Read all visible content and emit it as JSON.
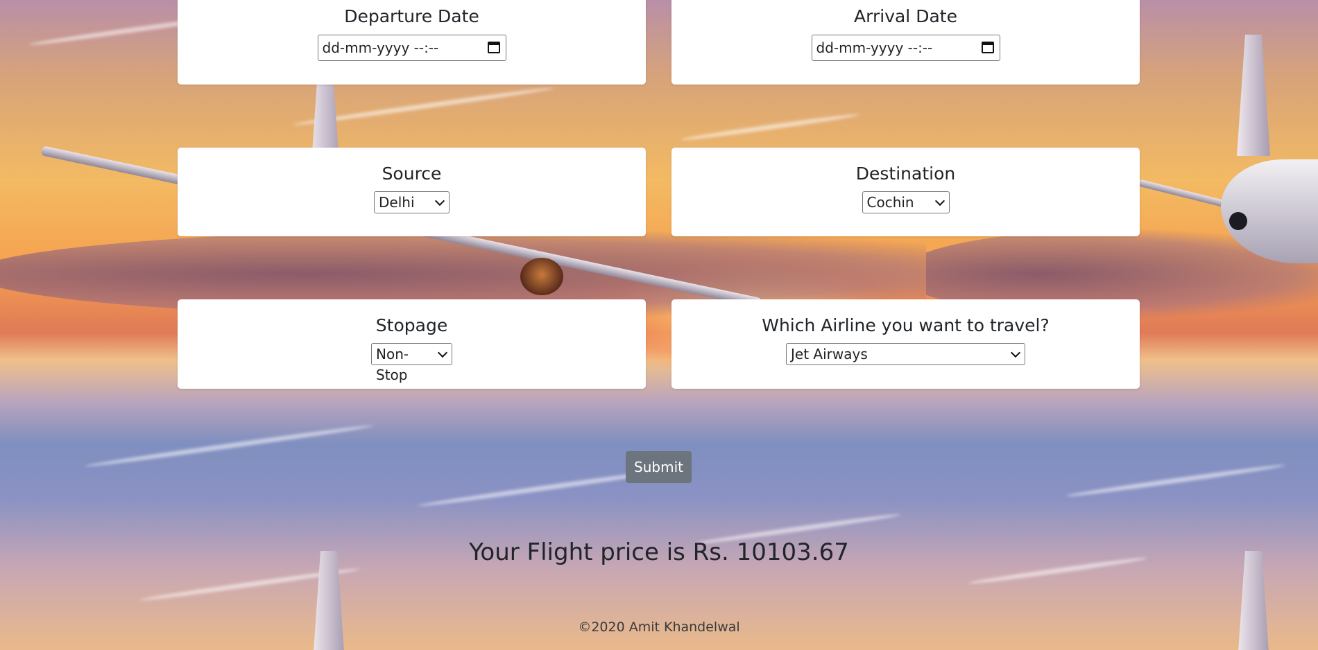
{
  "form": {
    "departure": {
      "label": "Departure Date",
      "placeholder": "dd-mm-yyyy --:--"
    },
    "arrival": {
      "label": "Arrival Date",
      "placeholder": "dd-mm-yyyy --:--"
    },
    "source": {
      "label": "Source",
      "selected": "Delhi"
    },
    "destination": {
      "label": "Destination",
      "selected": "Cochin"
    },
    "stopage": {
      "label": "Stopage",
      "selected": "Non-Stop"
    },
    "airline": {
      "label": "Which Airline you want to travel?",
      "selected": "Jet Airways"
    },
    "submit_label": "Submit"
  },
  "result": {
    "text": "Your Flight price is Rs. 10103.67"
  },
  "footer": {
    "text": "©2020 Amit Khandelwal"
  },
  "colors": {
    "button": "#6c757d",
    "card": "#ffffff",
    "text": "#212529"
  },
  "icons": {
    "date": "calendar-icon",
    "select": "chevron-down-icon"
  }
}
